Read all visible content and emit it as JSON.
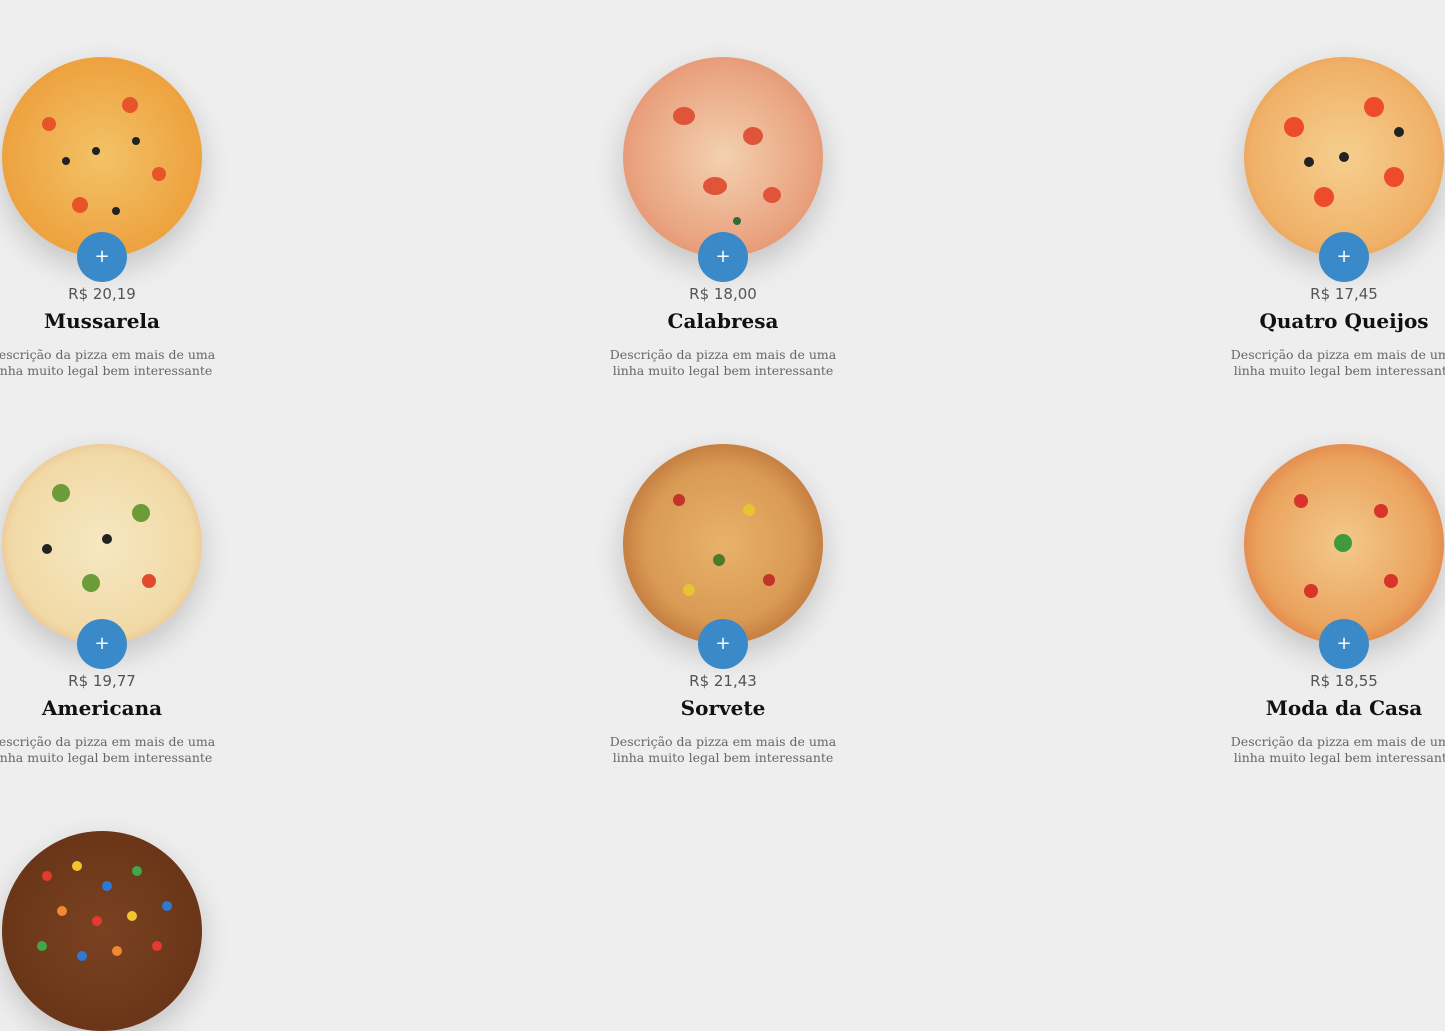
{
  "pizzas": [
    {
      "price": "R$ 20,19",
      "name": "Mussarela",
      "description": "Descrição da pizza em mais de uma linha muito legal bem interessante",
      "add_label": "+"
    },
    {
      "price": "R$ 18,00",
      "name": "Calabresa",
      "description": "Descrição da pizza em mais de uma linha muito legal bem interessante",
      "add_label": "+"
    },
    {
      "price": "R$ 17,45",
      "name": "Quatro Queijos",
      "description": "Descrição da pizza em mais de uma linha muito legal bem interessante",
      "add_label": "+"
    },
    {
      "price": "R$ 19,77",
      "name": "Americana",
      "description": "Descrição da pizza em mais de uma linha muito legal bem interessante",
      "add_label": "+"
    },
    {
      "price": "R$ 21,43",
      "name": "Sorvete",
      "description": "Descrição da pizza em mais de uma linha muito legal bem interessante",
      "add_label": "+"
    },
    {
      "price": "R$ 18,55",
      "name": "Moda da Casa",
      "description": "Descrição da pizza em mais de uma linha muito legal bem interessante",
      "add_label": "+"
    }
  ],
  "colors": {
    "accent": "#3a89c9",
    "background": "#eeeeee"
  }
}
